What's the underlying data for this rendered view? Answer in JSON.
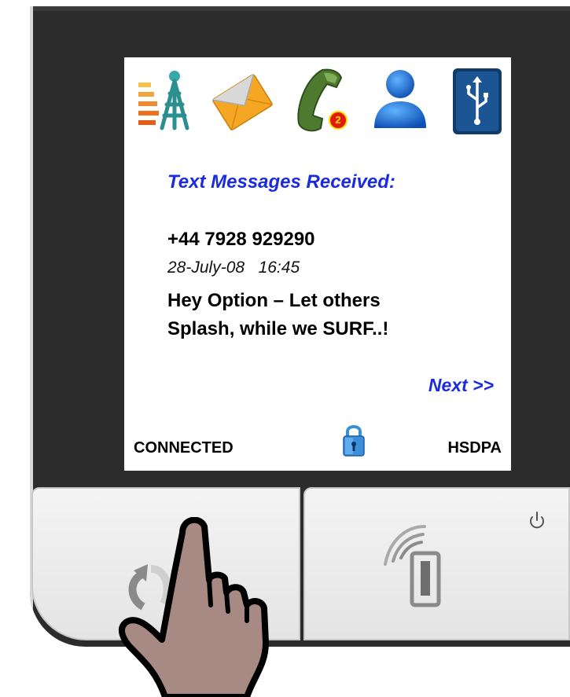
{
  "screen": {
    "icons": [
      "signal-tower-icon",
      "envelope-icon",
      "phone-handset-icon",
      "user-icon",
      "usb-icon"
    ],
    "missed_calls_badge": "2",
    "heading": "Text Messages Received:",
    "message": {
      "sender": "+44 7928 929290",
      "date": "28-July-08",
      "time": "16:45",
      "body_line1": "Hey Option – Let others",
      "body_line2": "Splash, while we SURF..!"
    },
    "next_label": "Next >>",
    "status": {
      "connection": "CONNECTED",
      "network": "HSDPA",
      "lock_icon": "padlock-icon"
    }
  },
  "buttons": {
    "left": "rotate-arrow-icon",
    "right": "wireless-device-icon",
    "power": "power-icon"
  },
  "colors": {
    "accent_blue": "#1a2be0",
    "device": "#2c2c2c",
    "button_face": "#ececec"
  }
}
